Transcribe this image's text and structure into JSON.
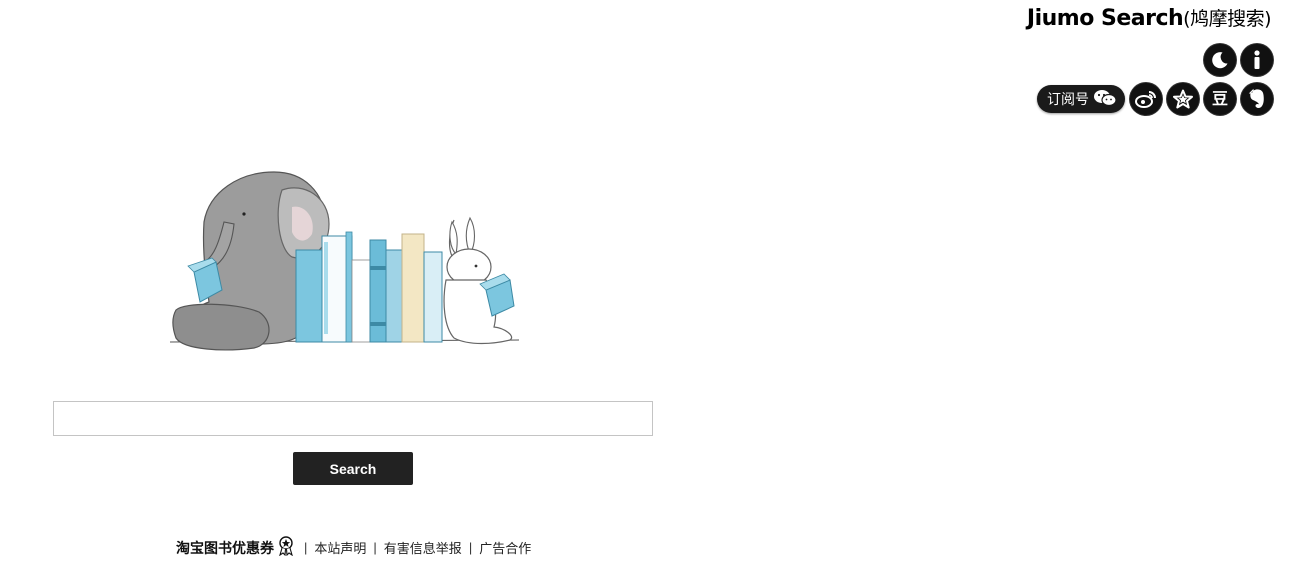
{
  "header": {
    "brand_en": "Jiumo Search",
    "brand_cn": "(鸠摩搜索)"
  },
  "toolbar": {
    "theme_icon": "moon-icon",
    "info_icon": "info-icon",
    "subscribe_label": "订阅号",
    "subscribe_icon": "wechat-icon",
    "weibo_icon": "weibo-icon",
    "star_icon": "star-icon",
    "douban_label": "豆",
    "evernote_icon": "evernote-icon"
  },
  "search": {
    "value": "",
    "placeholder": "",
    "button_label": "Search"
  },
  "footer": {
    "promo_label": "淘宝图书优惠券",
    "links": [
      "本站声明",
      "有害信息举报",
      "广告合作"
    ],
    "separator": "|"
  },
  "colors": {
    "icon_bg": "#111111",
    "button_bg": "#222222",
    "book_blue": "#7cc6df",
    "book_cream": "#f3e7c4"
  }
}
